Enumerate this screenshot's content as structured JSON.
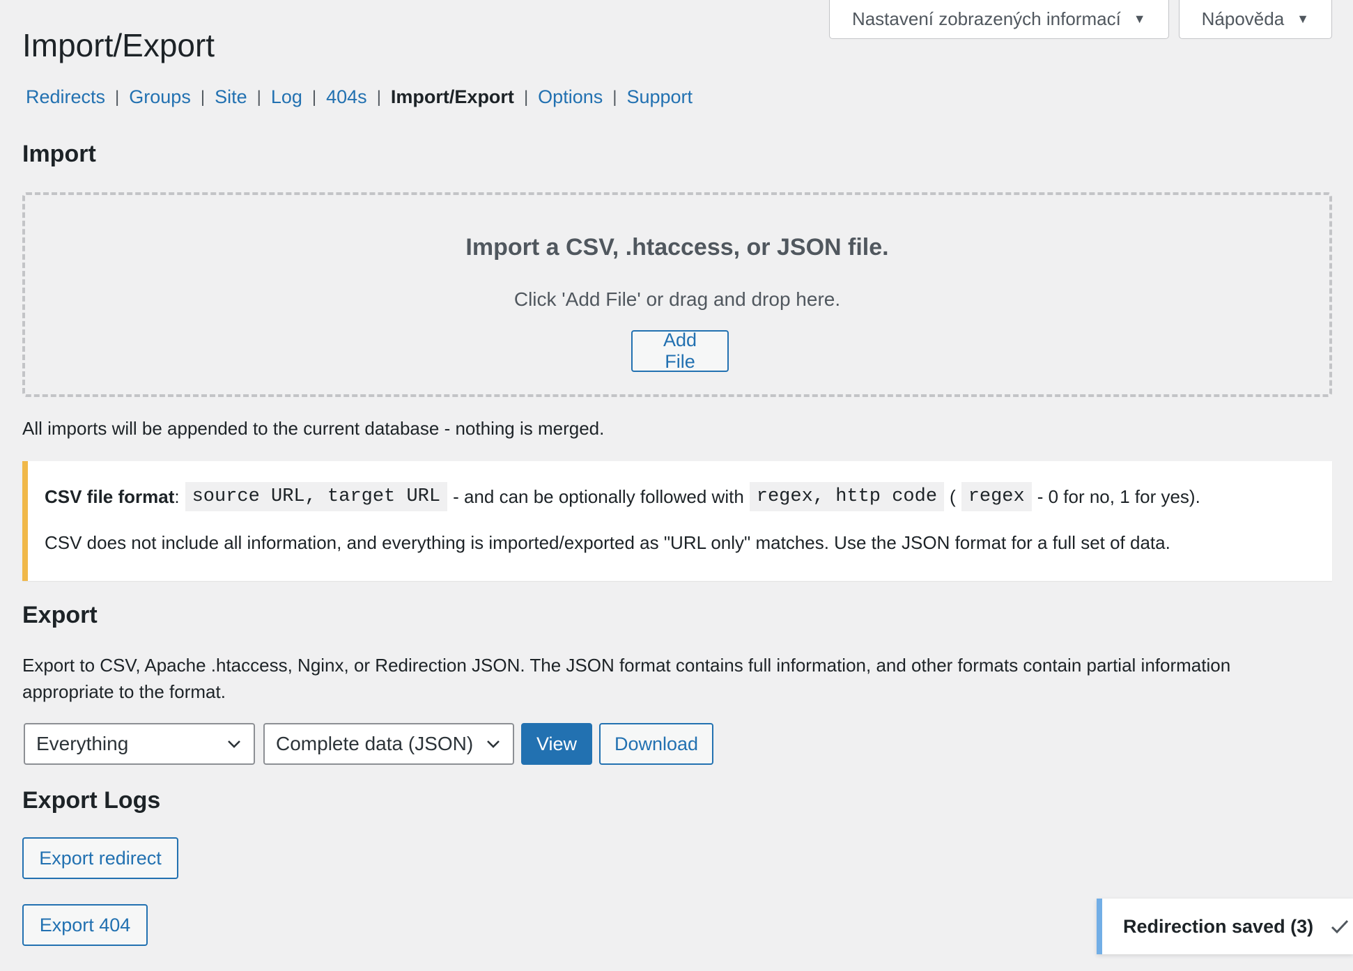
{
  "screen_meta": {
    "screen_options_label": "Nastavení zobrazených informací",
    "help_label": "Nápověda"
  },
  "page": {
    "title": "Import/Export"
  },
  "subnav": {
    "items": [
      {
        "label": "Redirects"
      },
      {
        "label": "Groups"
      },
      {
        "label": "Site"
      },
      {
        "label": "Log"
      },
      {
        "label": "404s"
      },
      {
        "label": "Import/Export",
        "current": true
      },
      {
        "label": "Options"
      },
      {
        "label": "Support"
      }
    ],
    "separator": "|"
  },
  "import": {
    "heading": "Import",
    "dropzone_title": "Import a CSV, .htaccess, or JSON file.",
    "dropzone_sub": "Click 'Add File' or drag and drop here.",
    "add_file_label": "Add File",
    "append_note": "All imports will be appended to the current database - nothing is merged."
  },
  "csv_notice": {
    "label": "CSV file format",
    "colon": ":",
    "code1": "source URL, target URL",
    "text1": "- and can be optionally followed with",
    "code2": "regex, http code",
    "paren_open": "(",
    "code3": "regex",
    "text2": "- 0 for no, 1 for yes).",
    "line2": "CSV does not include all information, and everything is imported/exported as \"URL only\" matches. Use the JSON format for a full set of data."
  },
  "export": {
    "heading": "Export",
    "description_line1": "Export to CSV, Apache .htaccess, Nginx, or Redirection JSON. The JSON format contains full information, and other formats contain partial information",
    "description_line2": "appropriate to the format.",
    "what_select_value": "Everything",
    "format_select_value": "Complete data (JSON)",
    "view_label": "View",
    "download_label": "Download"
  },
  "export_logs": {
    "heading": "Export Logs",
    "export_redirect_label": "Export redirect",
    "export_404_label": "Export 404"
  },
  "toast": {
    "message": "Redirection saved (3)"
  },
  "colors": {
    "accent": "#2271b1",
    "notice_border": "#f0b849",
    "toast_border": "#72aee6",
    "background": "#f0f0f1"
  }
}
